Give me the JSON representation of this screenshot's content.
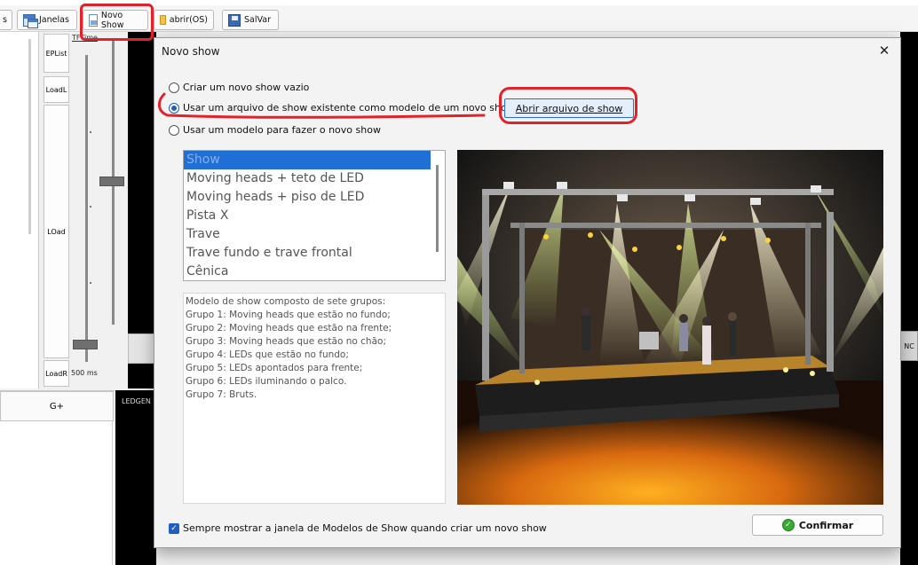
{
  "toolbar": {
    "partial_label": "s",
    "janelas_label": "Janelas",
    "novo_show_label": "Novo Show",
    "abrir_label": "abrir(OS)",
    "salvar_label": "SalVar"
  },
  "left_panel": {
    "eplist": "EPList",
    "loadl": "LoadL",
    "load": "LOad",
    "loadr": "LoadR",
    "tftime": "TFTime",
    "ms": "500 ms"
  },
  "bottom": {
    "gplus": "G+",
    "ledgen": "LEDGEN",
    "nc": "NC"
  },
  "dialog": {
    "title": "Novo show",
    "close_glyph": "✕",
    "radios": [
      {
        "label": "Criar um novo show vazio",
        "checked": false
      },
      {
        "label": "Usar um arquivo de show existente como modelo de um novo show",
        "checked": true
      },
      {
        "label": "Usar um modelo para fazer o novo show",
        "checked": false
      }
    ],
    "open_button": "Abrir arquivo de show",
    "list": [
      "Show",
      "Moving heads + teto de LED",
      "Moving heads + piso de LED",
      "Pista X",
      "Trave",
      "Trave fundo e trave frontal",
      "Cênica"
    ],
    "selected_index": 0,
    "description": [
      "Modelo de show composto de sete grupos:",
      "Grupo 1: Moving heads que estão no fundo;",
      "Grupo 2: Moving heads que estão na frente;",
      "Grupo 3: Moving heads que estão no chão;",
      "Grupo 4: LEDs que estão no fundo;",
      "Grupo 5: LEDs apontados para frente;",
      "Grupo 6: LEDs iluminando o palco.",
      "Grupo 7: Bruts."
    ],
    "always_show_label": "Sempre mostrar a janela de Modelos de Show quando criar um novo show",
    "always_show_checked": true,
    "confirm_label": "Confirmar"
  },
  "colors": {
    "accent": "#1e5fbf",
    "annotation": "#e2222b",
    "confirm_icon": "#3aaa35"
  }
}
